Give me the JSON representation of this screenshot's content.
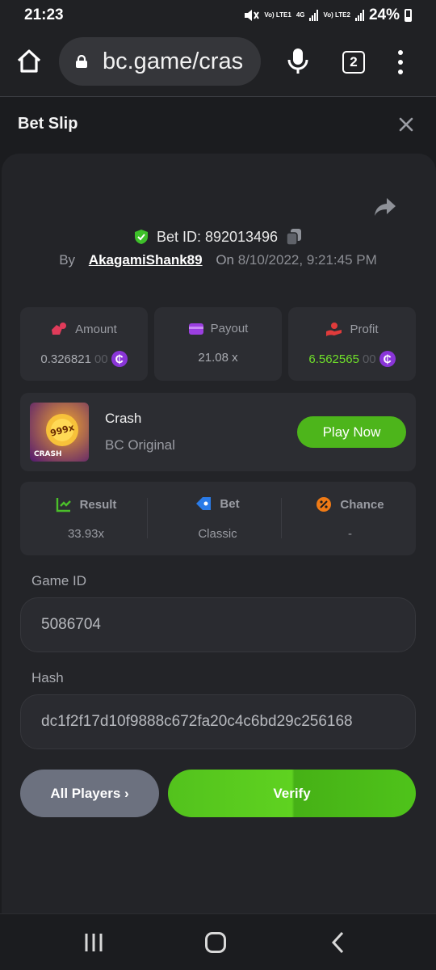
{
  "status_bar": {
    "time": "21:23",
    "net1": "Vo) LTE1",
    "net2_top": "4G",
    "net3": "Vo) LTE2",
    "battery": "24%"
  },
  "browser": {
    "url": "bc.game/cras",
    "tab_count": "2"
  },
  "header": {
    "title": "Bet Slip"
  },
  "bet": {
    "id_text": "Bet ID: 892013496",
    "by_label": "By",
    "username": "AkagamiShank89",
    "on_label": "On",
    "datetime": "8/10/2022, 9:21:45 PM"
  },
  "stats": {
    "amount": {
      "label": "Amount",
      "value_main": "0.32682100",
      "value_dim": "00",
      "value_strong": "0.326821"
    },
    "payout": {
      "label": "Payout",
      "value": "21.08 x"
    },
    "profit": {
      "label": "Profit",
      "value_strong": "6.562565",
      "value_dim": "00"
    }
  },
  "game": {
    "name": "Crash",
    "provider": "BC Original",
    "play_label": "Play Now",
    "thumb_text": "999x",
    "thumb_caption": "CRASH"
  },
  "results": {
    "result": {
      "label": "Result",
      "value": "33.93x"
    },
    "bet": {
      "label": "Bet",
      "value": "Classic"
    },
    "chance": {
      "label": "Chance",
      "value": "-"
    }
  },
  "fields": {
    "game_id_label": "Game ID",
    "game_id": "5086704",
    "hash_label": "Hash",
    "hash": "dc1f2f17d10f9888c672fa20c4c6bd29c256168"
  },
  "actions": {
    "all_players": "All Players ›",
    "verify": "Verify"
  },
  "colors": {
    "accent_green": "#4db51b",
    "coin_purple": "#8a35d8",
    "profit_green": "#6fdf2a",
    "badge_green": "#3ec02a"
  }
}
